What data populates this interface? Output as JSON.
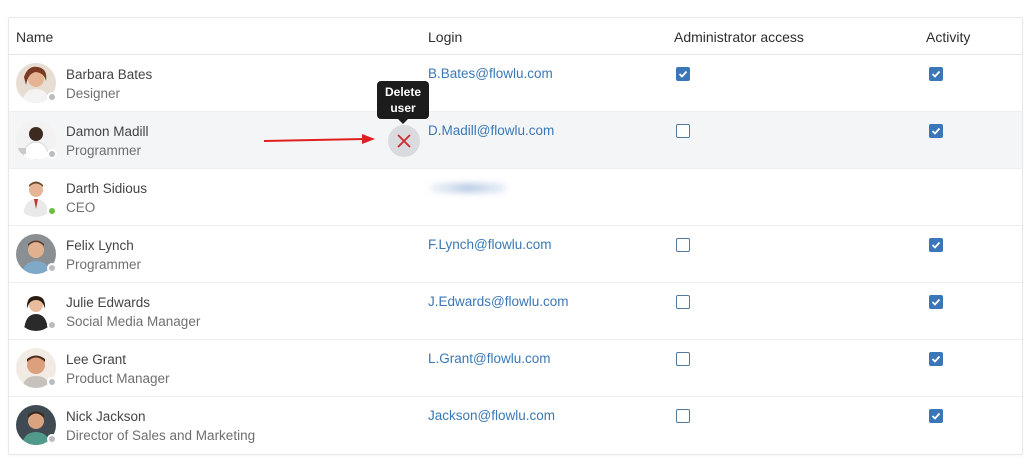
{
  "table": {
    "headers": {
      "name": "Name",
      "login": "Login",
      "admin": "Administrator access",
      "activity": "Activity"
    },
    "rows": [
      {
        "name": "Barbara Bates",
        "role": "Designer",
        "login": "B.Bates@flowlu.com",
        "admin": true,
        "activity": true,
        "status": "offline"
      },
      {
        "name": "Damon Madill",
        "role": "Programmer",
        "login": "D.Madill@flowlu.com",
        "admin": false,
        "activity": true,
        "status": "offline"
      },
      {
        "name": "Darth Sidious",
        "role": "CEO",
        "login": "",
        "admin": null,
        "activity": null,
        "status": "online"
      },
      {
        "name": "Felix Lynch",
        "role": "Programmer",
        "login": "F.Lynch@flowlu.com",
        "admin": false,
        "activity": true,
        "status": "offline"
      },
      {
        "name": "Julie Edwards",
        "role": "Social Media Manager",
        "login": "J.Edwards@flowlu.com",
        "admin": false,
        "activity": true,
        "status": "offline"
      },
      {
        "name": "Lee Grant",
        "role": "Product Manager",
        "login": "L.Grant@flowlu.com",
        "admin": false,
        "activity": true,
        "status": "offline"
      },
      {
        "name": "Nick Jackson",
        "role": "Director of Sales and Marketing",
        "login": "Jackson@flowlu.com",
        "admin": false,
        "activity": true,
        "status": "offline"
      }
    ]
  },
  "tooltip": {
    "line1": "Delete",
    "line2": "user"
  },
  "colors": {
    "accent": "#3b77b8",
    "link": "#3a78b5",
    "status_online": "#6cbf3a",
    "status_offline": "#b9bcc0",
    "delete_icon": "#d0282e",
    "arrow": "#e02020"
  },
  "icons": {
    "delete": "close-icon",
    "checkbox_checked": "check-icon"
  }
}
